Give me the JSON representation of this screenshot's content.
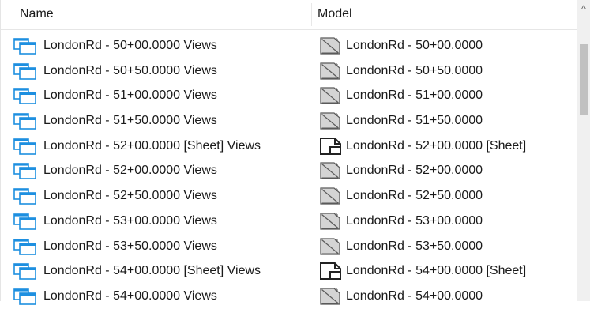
{
  "columns": {
    "name": "Name",
    "model": "Model"
  },
  "scrollbar": {
    "up_arrow": "^"
  },
  "rows": [
    {
      "name": "LondonRd - 50+00.0000 Views",
      "model": "LondonRd - 50+00.0000",
      "model_icon": "drawing-model-icon"
    },
    {
      "name": "LondonRd - 50+50.0000 Views",
      "model": "LondonRd - 50+50.0000",
      "model_icon": "drawing-model-icon"
    },
    {
      "name": "LondonRd - 51+00.0000 Views",
      "model": "LondonRd - 51+00.0000",
      "model_icon": "drawing-model-icon"
    },
    {
      "name": "LondonRd - 51+50.0000 Views",
      "model": "LondonRd - 51+50.0000",
      "model_icon": "drawing-model-icon"
    },
    {
      "name": "LondonRd - 52+00.0000 [Sheet] Views",
      "model": "LondonRd - 52+00.0000 [Sheet]",
      "model_icon": "sheet-model-icon"
    },
    {
      "name": "LondonRd - 52+00.0000 Views",
      "model": "LondonRd - 52+00.0000",
      "model_icon": "drawing-model-icon"
    },
    {
      "name": "LondonRd - 52+50.0000 Views",
      "model": "LondonRd - 52+50.0000",
      "model_icon": "drawing-model-icon"
    },
    {
      "name": "LondonRd - 53+00.0000 Views",
      "model": "LondonRd - 53+00.0000",
      "model_icon": "drawing-model-icon"
    },
    {
      "name": "LondonRd - 53+50.0000 Views",
      "model": "LondonRd - 53+50.0000",
      "model_icon": "drawing-model-icon"
    },
    {
      "name": "LondonRd - 54+00.0000 [Sheet] Views",
      "model": "LondonRd - 54+00.0000 [Sheet]",
      "model_icon": "sheet-model-icon"
    },
    {
      "name": "LondonRd - 54+00.0000 Views",
      "model": "LondonRd - 54+00.0000",
      "model_icon": "drawing-model-icon"
    }
  ]
}
